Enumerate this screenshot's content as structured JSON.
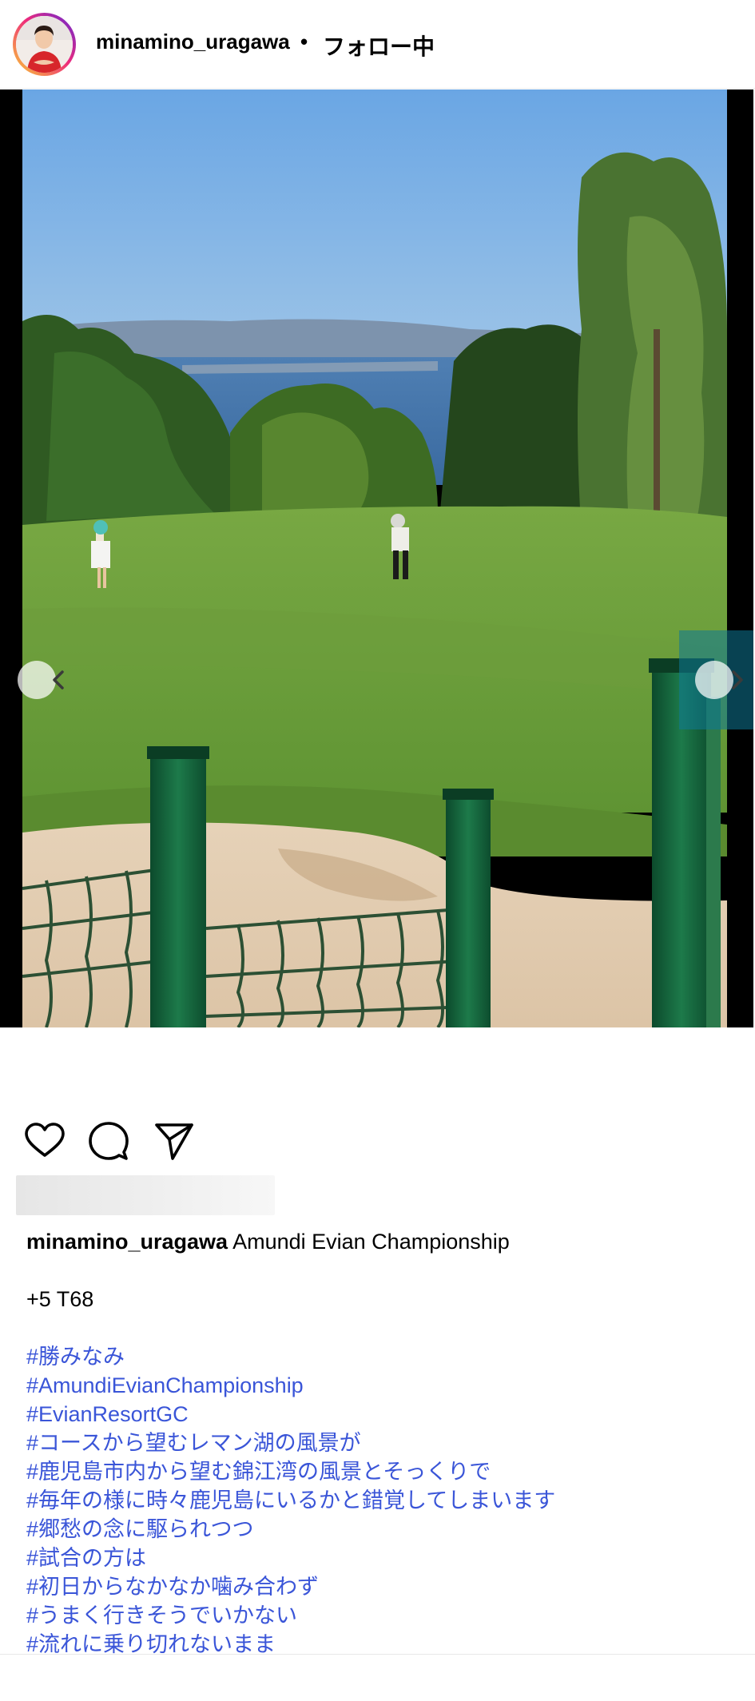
{
  "header": {
    "username": "minamino_uragawa",
    "separator": "•",
    "follow_status": "フォロー中"
  },
  "icons": {
    "avatar": "profile-photo",
    "prev": "chevron-left-icon",
    "next": "chevron-right-icon",
    "mute": "speaker-muted-icon",
    "like": "heart-icon",
    "comment": "comment-bubble-icon",
    "share": "paper-plane-icon"
  },
  "colors": {
    "hashtag": "#3a55d8",
    "story_ring": [
      "#f9ce34",
      "#ee2a7b",
      "#6228d7"
    ]
  },
  "caption": {
    "username": "minamino_uragawa",
    "title": "Amundi Evian Championship",
    "score": "+5 T68",
    "hashtags": [
      "#勝みなみ",
      "#AmundiEvianChampionship",
      "#EvianResortGC",
      "#コースから望むレマン湖の風景が",
      "#鹿児島市内から望む錦江湾の風景とそっくりで",
      "#毎年の様に時々鹿児島にいるかと錯覚してしまいます",
      "#郷愁の念に駆られつつ",
      "#試合の方は",
      "#初日からなかなか噛み合わず",
      "#うまく行きそうでいかない",
      "#流れに乗り切れないまま"
    ]
  }
}
